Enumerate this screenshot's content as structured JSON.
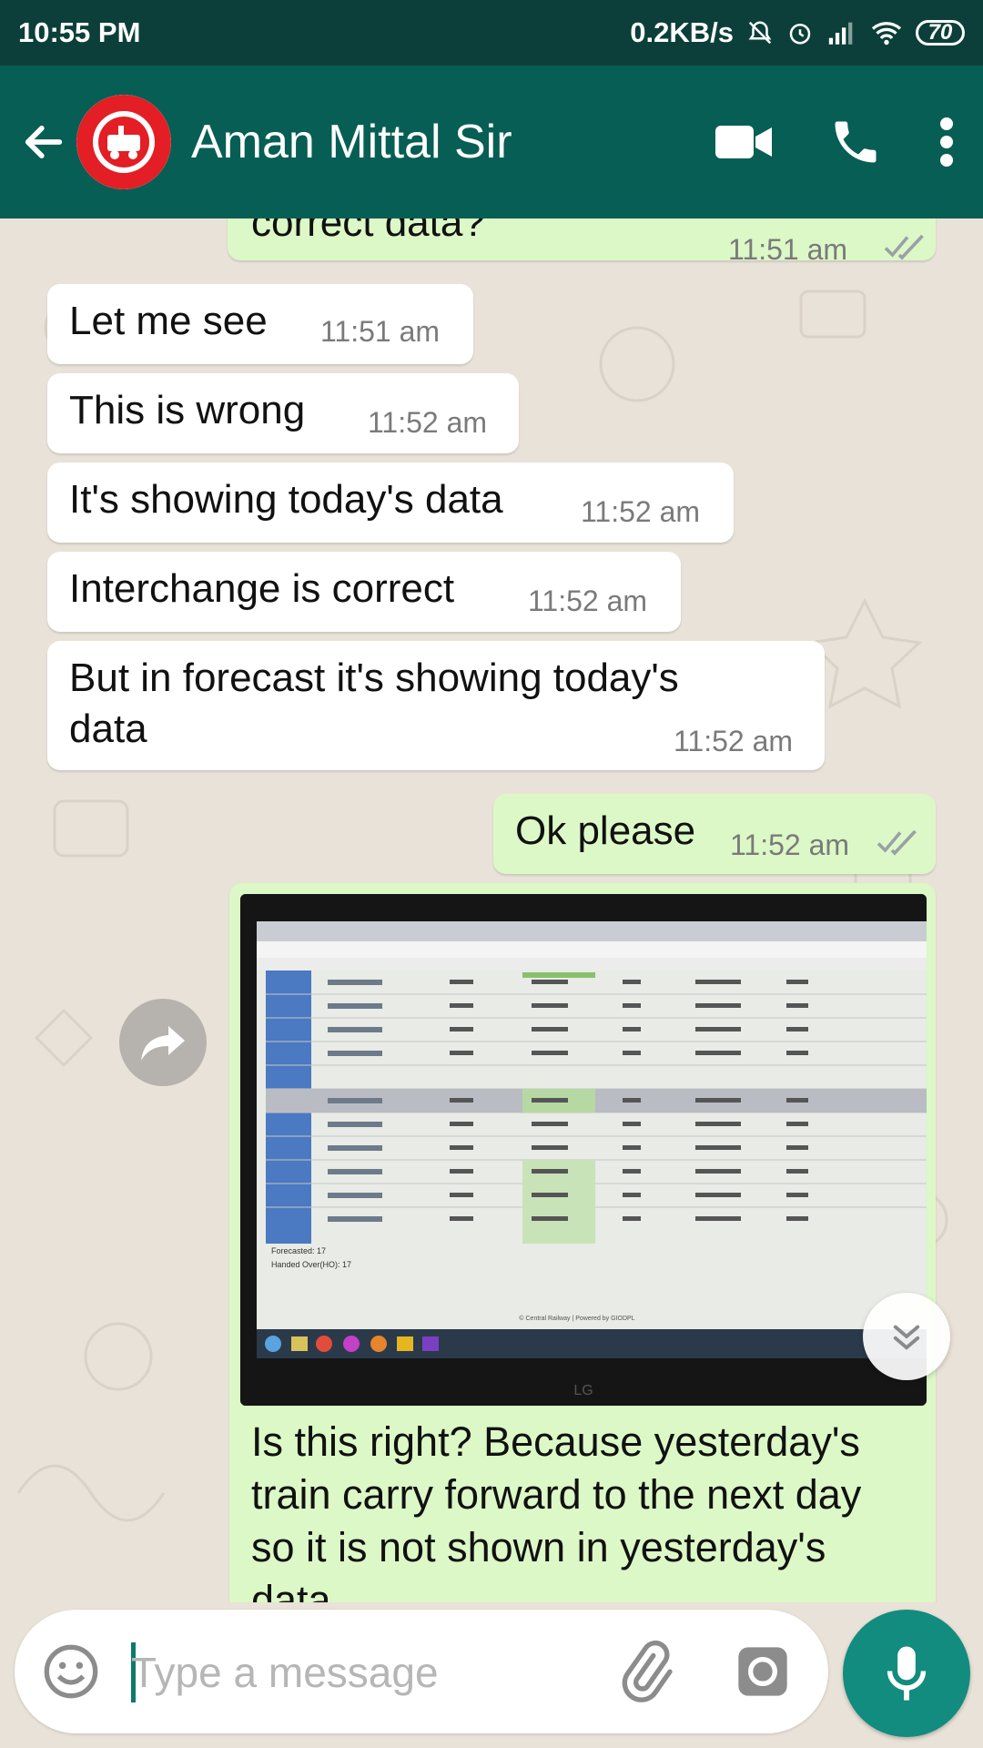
{
  "status_bar": {
    "time": "10:55 PM",
    "speed": "0.2KB/s",
    "battery": "70"
  },
  "header": {
    "contact_name": "Aman Mittal Sir"
  },
  "messages": [
    {
      "dir": "out",
      "text": "correct data?",
      "time": "11:51 am"
    },
    {
      "dir": "in",
      "text": "Let me see",
      "time": "11:51 am"
    },
    {
      "dir": "in",
      "text": "This is wrong",
      "time": "11:52 am"
    },
    {
      "dir": "in",
      "text": "It's showing today's data",
      "time": "11:52 am"
    },
    {
      "dir": "in",
      "text": "Interchange is correct",
      "time": "11:52 am"
    },
    {
      "dir": "in",
      "text_line1": "But in forecast it's showing today's",
      "text_line2": "data",
      "time": "11:52 am"
    },
    {
      "dir": "out",
      "text": "Ok please",
      "time": "11:52 am"
    },
    {
      "dir": "out",
      "type": "image",
      "caption_line1": "Is this right? Because yesterday's",
      "caption_line2": "train carry forward to the next day",
      "caption_line3": "so it is not shown in yesterday's",
      "caption_line4": "data"
    }
  ],
  "photo": {
    "forecasted": "Forecasted: 17",
    "handed_over": "Handed Over(HO): 17",
    "footer": "© Central Railway | Powered by GIODPL",
    "brand": "LG"
  },
  "input": {
    "placeholder": "Type a message"
  },
  "icons": {
    "back": "arrow-left-icon",
    "video": "video-camera-icon",
    "call": "phone-icon",
    "menu": "more-vert-icon",
    "share": "forward-icon",
    "scroll": "chevron-double-down-icon",
    "emoji": "smiley-icon",
    "attach": "paperclip-icon",
    "camera": "camera-icon",
    "mic": "microphone-icon"
  },
  "colors": {
    "header": "#075e54",
    "status": "#0c3f39",
    "outgoing": "#dcf8c6",
    "incoming": "#ffffff",
    "accent": "#128c7e"
  }
}
